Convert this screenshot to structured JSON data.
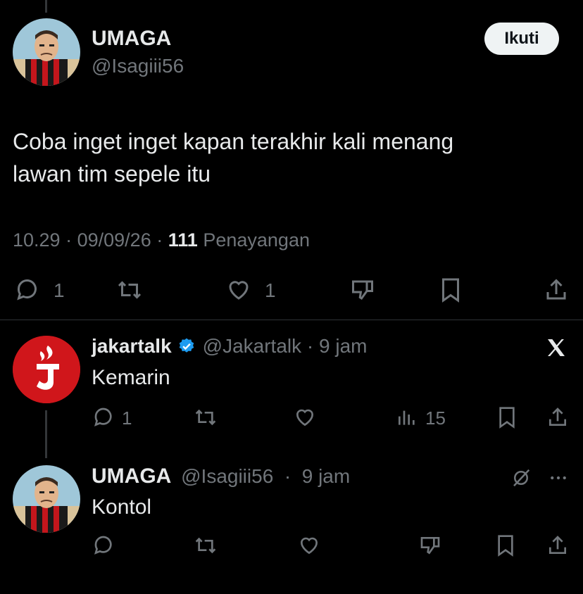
{
  "main_tweet": {
    "author_name": "UMAGA",
    "author_handle": "@Isagiii56",
    "follow_label": "Ikuti",
    "text_line1": "Coba inget inget kapan terakhir kali menang",
    "text_line2": "lawan tim sepele itu",
    "time": "10.29",
    "date": "09/09/26",
    "views_count": "111",
    "views_label": "Penayangan",
    "reply_count": "1",
    "like_count": "1"
  },
  "reply1": {
    "author_name": "jakartalk",
    "author_handle": "@Jakartalk",
    "age": "9 jam",
    "text": "Kemarin",
    "reply_count": "1",
    "views_count": "15",
    "brand_icon": "x-logo-icon"
  },
  "reply2": {
    "author_name": "UMAGA",
    "author_handle": "@Isagiii56",
    "age": "9 jam",
    "text": "Kontol"
  },
  "colors": {
    "background": "#000000",
    "text": "#e7e9ea",
    "muted": "#71767b",
    "verified": "#1d9bf0",
    "jakartalk_red": "#d0161b"
  }
}
